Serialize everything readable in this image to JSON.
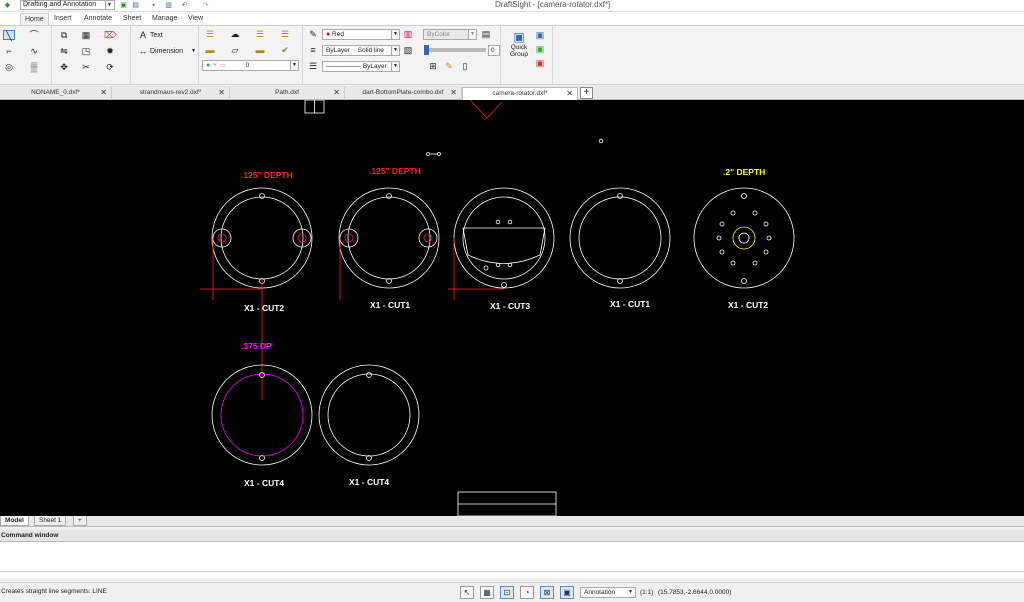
{
  "app": {
    "title": "DraftSight - [camera-rotator.dxf*]",
    "workspace": "Drafting and Annotation"
  },
  "ribbon_tabs": [
    "Home",
    "Insert",
    "Annotate",
    "Sheet",
    "Manage",
    "View"
  ],
  "ribbon": {
    "groups": {
      "quick_group_1": "Quick",
      "quick_group_2": "Group"
    },
    "annotations": {
      "text": "Text",
      "dimension": "Dimension"
    },
    "layers": {
      "current_layer": "0"
    },
    "properties": {
      "color": "Red",
      "color_swatch": "#e00000",
      "bycolor": "ByColor",
      "linetype_layer": "ByLayer",
      "linetype": "Solid line",
      "lineweight": "ByLayer",
      "transparency": "0"
    }
  },
  "doc_tabs": [
    {
      "label": "NONAME_0.dxf*",
      "active": false
    },
    {
      "label": "strandmaus-rev2.dxf*",
      "active": false
    },
    {
      "label": "Path.dxf",
      "active": false
    },
    {
      "label": "dart-BottomPlate-combo.dxf",
      "active": false
    },
    {
      "label": "camera-rotator.dxf*",
      "active": true
    }
  ],
  "drawing": {
    "labels": {
      "depth1": ".125\" DEPTH",
      "depth2": ".125\" DEPTH",
      "depth3": ".2\" DEPTH",
      "depth4": ".375 DP",
      "cut_a": "X1 - CUT2",
      "cut_b": "X1 - CUT1",
      "cut_c": "X1 - CUT3",
      "cut_d": "X1 - CUT1",
      "cut_e": "X1 - CUT2",
      "cut_f": "X1 - CUT4",
      "cut_g": "X1 - CUT4"
    },
    "colors": {
      "red": "#ff2020",
      "yellow": "#ffff00",
      "magenta": "#ff00ff",
      "white": "#ffffff"
    }
  },
  "model_tabs": [
    "Model",
    "Sheet 1"
  ],
  "command_window": {
    "title": "Command window"
  },
  "status": {
    "prompt": "Creates straight line segments:  LINE",
    "annotation": "Annotation",
    "scale": "(1:1)",
    "coords": "(15.7853,-2.6644,0.0000)"
  }
}
